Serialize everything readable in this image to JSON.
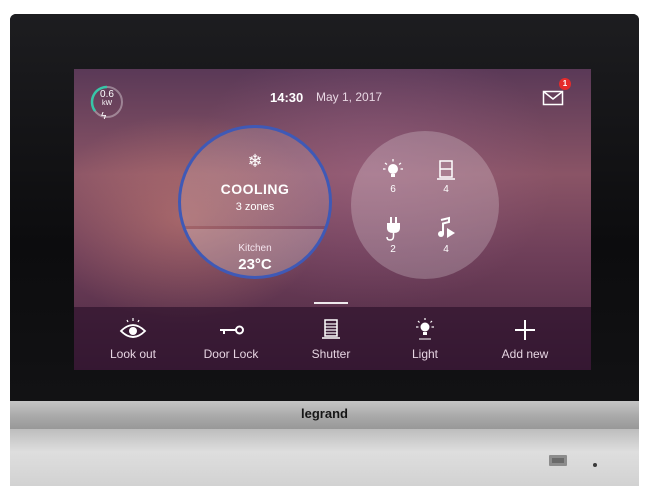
{
  "status": {
    "power_value": "0.6",
    "power_unit": "kW",
    "time": "14:30",
    "date": "May 1, 2017",
    "unread_messages": "1"
  },
  "climate": {
    "mode": "COOLING",
    "zones": "3 zones",
    "room": "Kitchen",
    "temperature": "23°C",
    "icon": "snowflake-icon"
  },
  "devices": [
    {
      "icon": "lightbulb-icon",
      "count": "6"
    },
    {
      "icon": "shutter-icon",
      "count": "4"
    },
    {
      "icon": "plug-icon",
      "count": "2"
    },
    {
      "icon": "music-icon",
      "count": "4"
    }
  ],
  "dock": [
    {
      "icon": "eye-icon",
      "label": "Look out"
    },
    {
      "icon": "key-icon",
      "label": "Door Lock"
    },
    {
      "icon": "shutter-icon",
      "label": "Shutter"
    },
    {
      "icon": "lightbulb-icon",
      "label": "Light"
    },
    {
      "icon": "plus-icon",
      "label": "Add new"
    }
  ],
  "brand": "legrand",
  "colors": {
    "accent_ring": "#3f59b6",
    "badge": "#e52b2b"
  }
}
